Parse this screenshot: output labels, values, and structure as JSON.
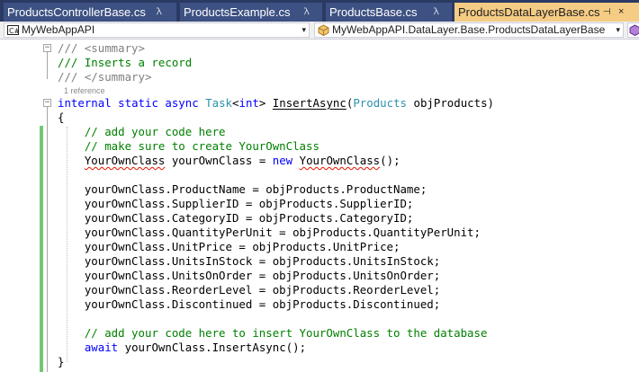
{
  "tabs": [
    {
      "label": "ProductsControllerBase.cs",
      "pin": "ꟛ"
    },
    {
      "label": "ProductsExample.cs",
      "pin": "ꟛ"
    },
    {
      "label": "ProductsBase.cs",
      "pin": "ꟛ"
    },
    {
      "label": "ProductsDataLayerBase.cs",
      "pin": "⊣",
      "close": "×"
    }
  ],
  "nav": {
    "project": "MyWebAppAPI",
    "type": "MyWebAppAPI.DataLayer.Base.ProductsDataLayerBase",
    "arrow": "▾"
  },
  "code": {
    "summary_open": "/// <summary>",
    "summary_text": "/// Inserts a record",
    "summary_close": "/// </summary>",
    "references": "1 reference",
    "sig_internal": "internal",
    "sig_static": "static",
    "sig_async": "async",
    "sig_task": "Task",
    "sig_int": "int",
    "sig_method": "InsertAsync",
    "sig_param_type": "Products",
    "sig_param_name": "objProducts",
    "brace_open": "{",
    "comment1": "// add your code here",
    "comment2": "// make sure to create YourOwnClass",
    "decl_type": "YourOwnClass",
    "decl_var": "yourOwnClass",
    "decl_new": "new",
    "decl_ctor": "YourOwnClass",
    "assignments": [
      "yourOwnClass.ProductName = objProducts.ProductName;",
      "yourOwnClass.SupplierID = objProducts.SupplierID;",
      "yourOwnClass.CategoryID = objProducts.CategoryID;",
      "yourOwnClass.QuantityPerUnit = objProducts.QuantityPerUnit;",
      "yourOwnClass.UnitPrice = objProducts.UnitPrice;",
      "yourOwnClass.UnitsInStock = objProducts.UnitsInStock;",
      "yourOwnClass.UnitsOnOrder = objProducts.UnitsOnOrder;",
      "yourOwnClass.ReorderLevel = objProducts.ReorderLevel;",
      "yourOwnClass.Discontinued = objProducts.Discontinued;"
    ],
    "comment3": "// add your code here to insert YourOwnClass to the database",
    "await_kw": "await",
    "await_call": "yourOwnClass.InsertAsync();",
    "brace_close": "}"
  },
  "colors": {
    "keyword": "#0000ff",
    "type": "#2b91af",
    "comment": "#008000",
    "change_bar": "#73c973",
    "active_tab": "#f5cc84"
  },
  "icons": {
    "project_icon": "csharp-project-icon",
    "type_icon": "class-icon",
    "member_icon": "method-icon"
  }
}
